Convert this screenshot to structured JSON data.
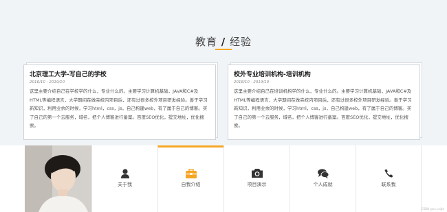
{
  "section": {
    "title_left": "教育",
    "title_sep": "/",
    "title_right": "经验"
  },
  "cards": [
    {
      "title": "北京理工大学-写自己的学校",
      "date": "2016/10 - 2019/10",
      "desc": "这里主要介绍自己在学校学的什么，专业什么的。主要学习计算机基础，JAVA和C#及HTML等编程语言，大学期间在做完校内项目后，还有过很多校外项目研发经验。善于学习新知识，利用业余的时候，学习html，css，js，自己构建web，有了属于自己的博客。买了自己的第一个云服务，域名，把个人博客进行备案。百度SEO优化，提交地址，优化搜索。"
    },
    {
      "title": "校外专业培训机构-培训机构",
      "date": "2018/10 - 2019/10",
      "desc": "这里主要介绍自己在培训机构学的什么，专业什么的。主要学习计算机基础，JAVA和C#及HTML等编程语言，大学期间在做完校内项目后，还有过很多校外项目研发经验。善于学习新知识，利用业余的时候，学习html，css，js，自己构建web，有了属于自己的博客。买了自己的第一个云服务，域名，把个人博客进行备案。百度SEO优化，提交地址，优化搜索。"
    }
  ],
  "nav": {
    "items": [
      {
        "label": "关于我",
        "icon": "user-icon",
        "active": false
      },
      {
        "label": "自我介绍",
        "icon": "briefcase-icon",
        "active": true
      },
      {
        "label": "项目演示",
        "icon": "camera-icon",
        "active": false
      },
      {
        "label": "个人成就",
        "icon": "comments-icon",
        "active": false
      },
      {
        "label": "联系我",
        "icon": "phone-icon",
        "active": false
      }
    ],
    "active_color": "#f5a623",
    "icon_color": "#333333"
  },
  "watermark": "CSDN @cc.Leigh"
}
